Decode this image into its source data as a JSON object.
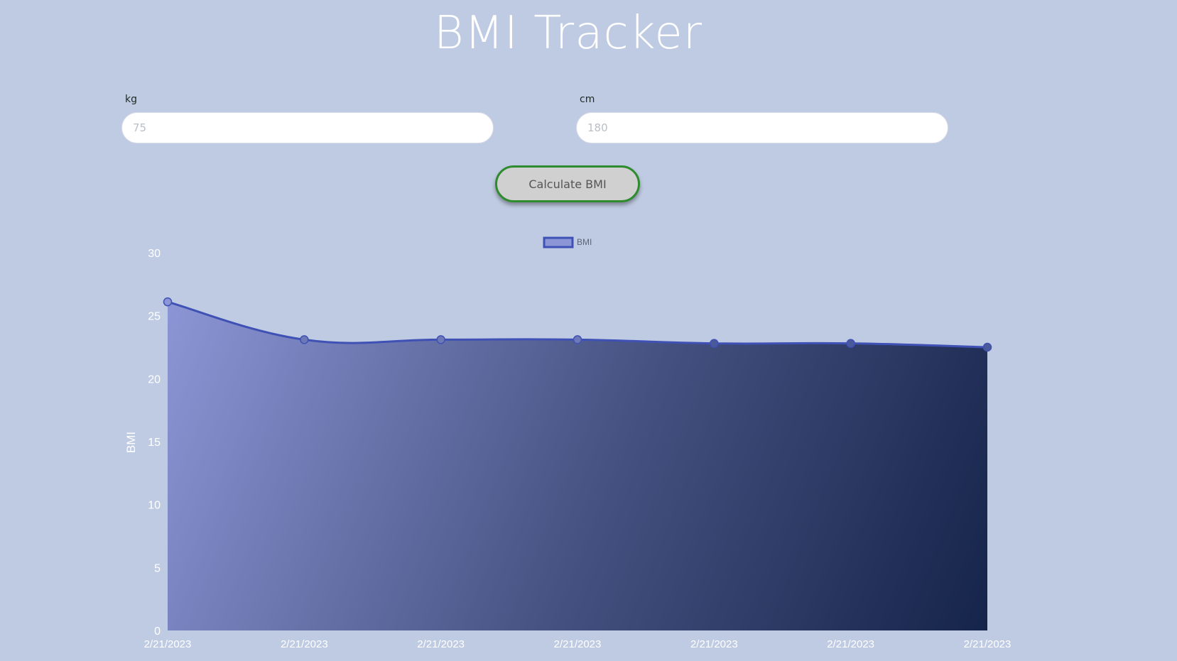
{
  "header": {
    "title": "BMI Tracker"
  },
  "form": {
    "weight": {
      "label": "kg",
      "placeholder": "75",
      "value": ""
    },
    "height": {
      "label": "cm",
      "placeholder": "180",
      "value": ""
    },
    "submit_label": "Calculate BMI"
  },
  "colors": {
    "background": "#bfcbe2",
    "line": "#3f51b5",
    "fill_top": "#8c96d6",
    "fill_bottom": "#15244a",
    "button_border": "#2e8b2e",
    "button_bg": "#d0d0d0"
  },
  "chart_data": {
    "type": "area",
    "categories": [
      "2/21/2023",
      "2/21/2023",
      "2/21/2023",
      "2/21/2023",
      "2/21/2023",
      "2/21/2023",
      "2/21/2023"
    ],
    "series": [
      {
        "name": "BMI",
        "values": [
          26.1,
          23.1,
          23.1,
          23.1,
          22.8,
          22.8,
          22.5
        ]
      }
    ],
    "yticks": [
      0,
      5,
      10,
      15,
      20,
      25,
      30
    ],
    "ylim": [
      0,
      30
    ],
    "xlabel": "",
    "ylabel": "BMI",
    "legend": "top-center",
    "grid": false
  }
}
